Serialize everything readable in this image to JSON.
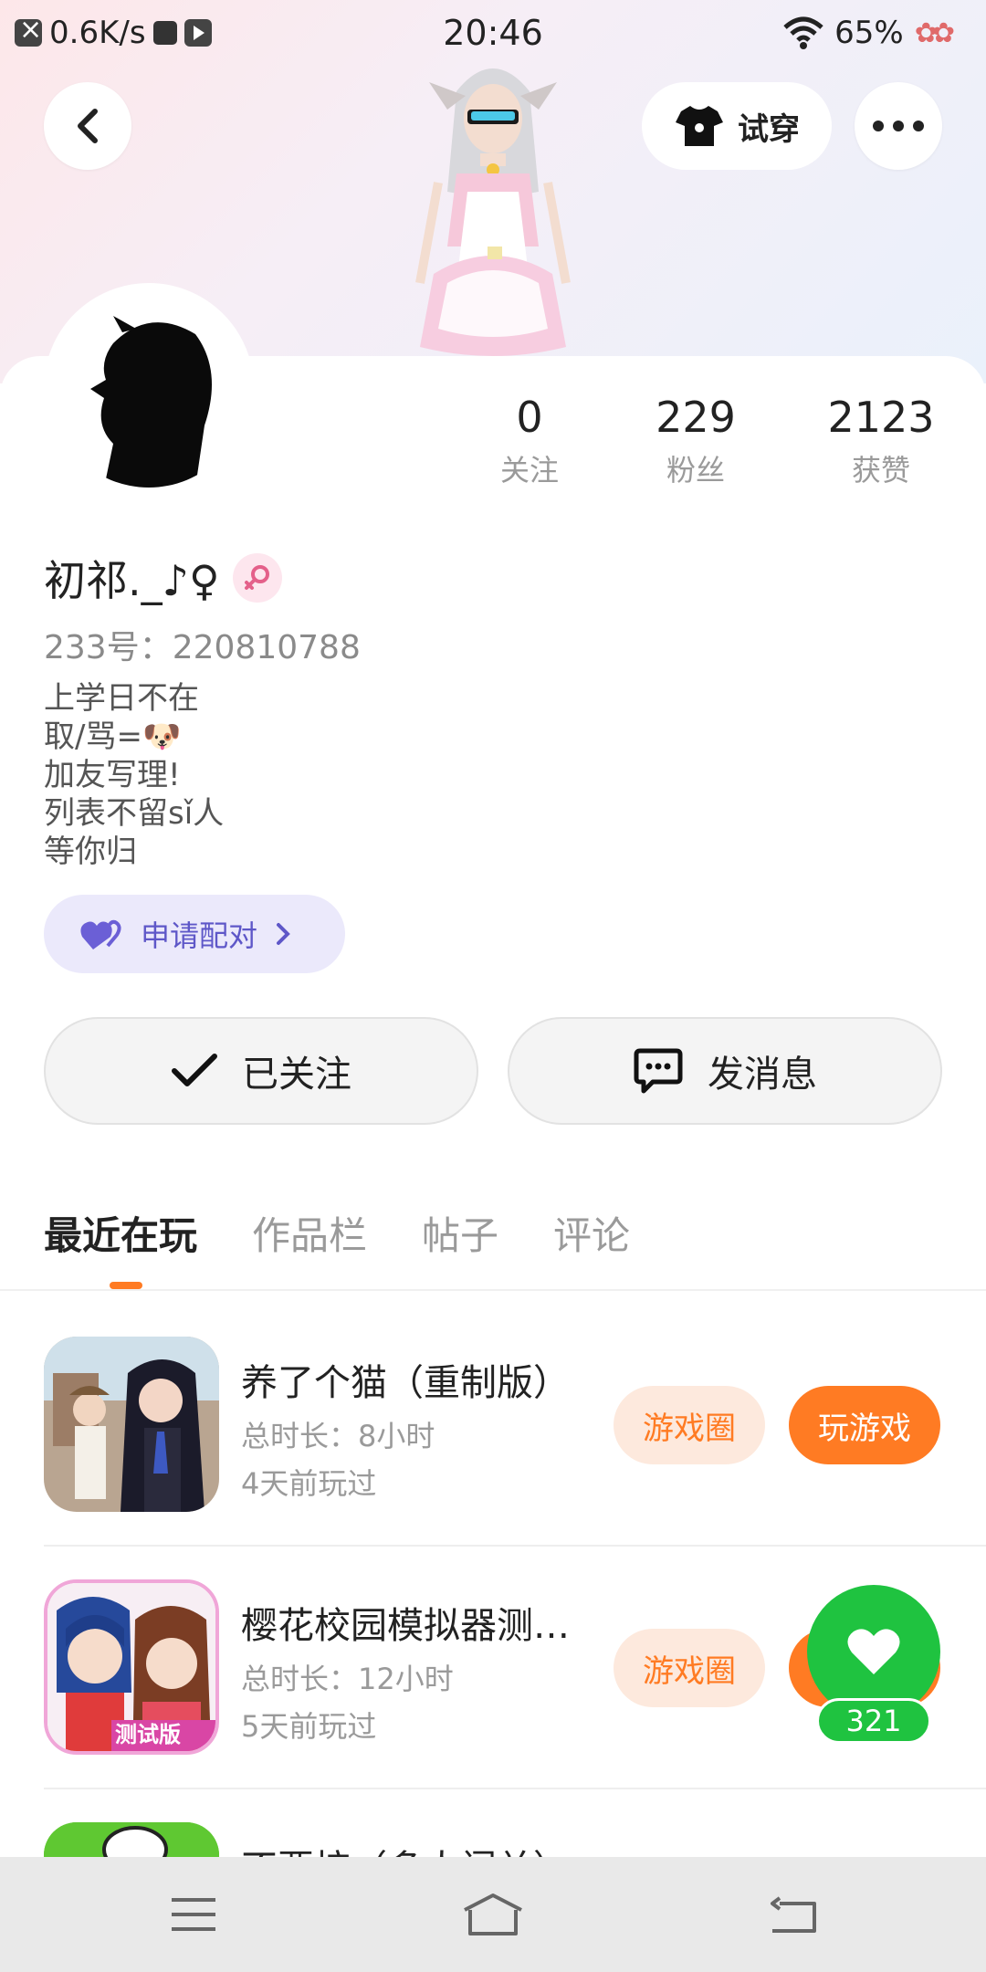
{
  "status_bar": {
    "net_speed": "0.6K/s",
    "time": "20:46",
    "battery": "65%",
    "icons": [
      "close-notification-icon",
      "square-icon",
      "media-play-icon",
      "wifi-icon",
      "flower-icon"
    ]
  },
  "header": {
    "back_icon": "chevron-left-icon",
    "try_on_label": "试穿",
    "try_on_icon": "shirt-icon",
    "more_icon": "more-dots-icon"
  },
  "profile": {
    "stats": [
      {
        "num": "0",
        "label": "关注"
      },
      {
        "num": "229",
        "label": "粉丝"
      },
      {
        "num": "2123",
        "label": "获赞"
      }
    ],
    "name": "初祁._♪♀",
    "gender_icon": "female-symbol-icon",
    "uid": "233号：220810788",
    "bio": [
      "上学日不在",
      "取/骂=🐶",
      "加友写理!",
      "列表不留sǐ人",
      "等你归"
    ],
    "pair_button": "申请配对",
    "follow_button": "已关注",
    "message_button": "发消息"
  },
  "tabs": [
    "最近在玩",
    "作品栏",
    "帖子",
    "评论"
  ],
  "games": [
    {
      "title": "养了个猫（重制版）",
      "duration": "总时长：8小时",
      "last_played": "4天前玩过",
      "circle_label": "游戏圈",
      "play_label": "玩游戏"
    },
    {
      "title": "樱花校园模拟器测…",
      "duration": "总时长：12小时",
      "last_played": "5天前玩过",
      "circle_label": "游戏圈",
      "badge": "测试版"
    },
    {
      "title": "不要按（多人闯关）"
    }
  ],
  "like_fab": {
    "count": "321",
    "icon": "heart-icon"
  },
  "nav_bar": {
    "icons": [
      "menu-icon",
      "home-icon",
      "back-icon"
    ]
  },
  "colors": {
    "accent": "#ff7b23",
    "pair_purple": "#5e57c8",
    "like_green": "#1fc340"
  }
}
